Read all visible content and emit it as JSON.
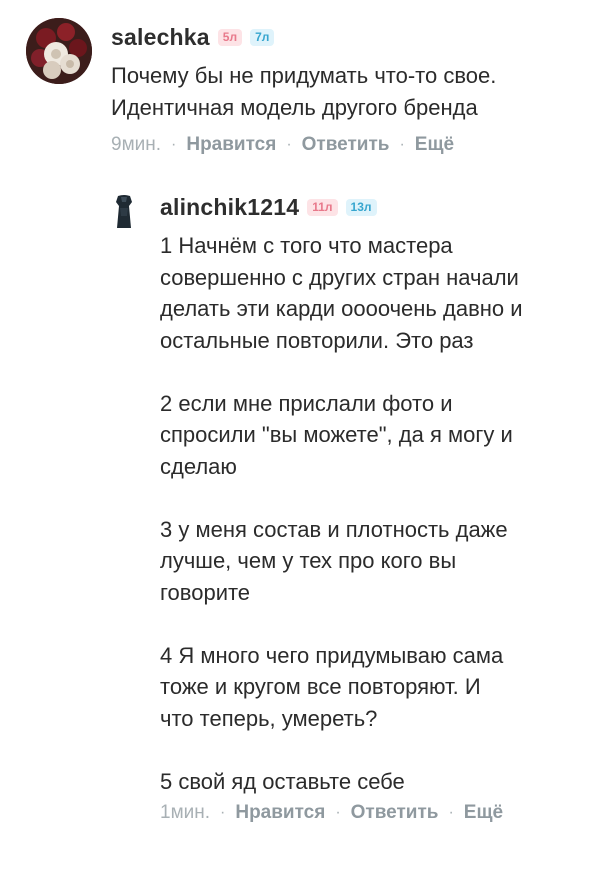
{
  "comments": [
    {
      "author": "salechka",
      "badges": [
        "5л",
        "7л"
      ],
      "text": "Почему бы не придумать что-то свое.\nИдентичная модель другого бренда",
      "time": "9мин.",
      "like_label": "Нравится",
      "reply_label": "Ответить",
      "more_label": "Ещё",
      "separator": "·"
    },
    {
      "author": "alinchik1214",
      "badges": [
        "11л",
        "13л"
      ],
      "text": "1 Начнём с того что мастера\nсовершенно с других стран начали\nделать эти карди оооочень давно и\nостальные повторили. Это раз\n\n2 если мне прислали фото и\nспросили \"вы можете\", да я могу и\nсделаю\n\n3 у меня состав и плотность даже\nлучше, чем у тех про кого вы\nговорите\n\n4  Я много чего придумываю сама\nтоже и кругом все повторяют. И\nчто теперь, умереть?\n\n5 свой яд оставьте себе",
      "time": "1мин.",
      "like_label": "Нравится",
      "reply_label": "Ответить",
      "more_label": "Ещё",
      "separator": "·"
    }
  ],
  "colors": {
    "badge_pink_bg": "#fde3e6",
    "badge_pink_text": "#e8798b",
    "badge_blue_bg": "#dff3fb",
    "badge_blue_text": "#37a6cf",
    "action_text": "#8f999f"
  }
}
